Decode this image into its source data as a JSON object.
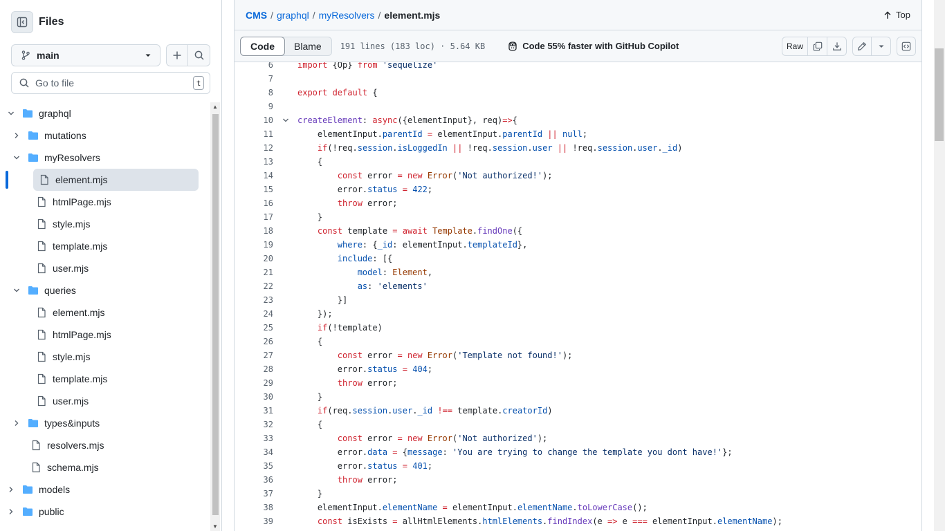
{
  "sidebar": {
    "title": "Files",
    "branch": "main",
    "goto_placeholder": "Go to file",
    "goto_shortcut": "t",
    "tree": [
      {
        "label": "graphql",
        "type": "folder",
        "depth": 1,
        "expanded": true
      },
      {
        "label": "mutations",
        "type": "folder",
        "depth": 2,
        "expanded": false
      },
      {
        "label": "myResolvers",
        "type": "folder",
        "depth": 2,
        "expanded": true
      },
      {
        "label": "element.mjs",
        "type": "file",
        "depth": 3,
        "active": true
      },
      {
        "label": "htmlPage.mjs",
        "type": "file",
        "depth": 3
      },
      {
        "label": "style.mjs",
        "type": "file",
        "depth": 3
      },
      {
        "label": "template.mjs",
        "type": "file",
        "depth": 3
      },
      {
        "label": "user.mjs",
        "type": "file",
        "depth": 3
      },
      {
        "label": "queries",
        "type": "folder",
        "depth": 2,
        "expanded": true
      },
      {
        "label": "element.mjs",
        "type": "file",
        "depth": 3
      },
      {
        "label": "htmlPage.mjs",
        "type": "file",
        "depth": 3
      },
      {
        "label": "style.mjs",
        "type": "file",
        "depth": 3
      },
      {
        "label": "template.mjs",
        "type": "file",
        "depth": 3
      },
      {
        "label": "user.mjs",
        "type": "file",
        "depth": 3
      },
      {
        "label": "types&inputs",
        "type": "folder",
        "depth": 2,
        "expanded": false
      },
      {
        "label": "resolvers.mjs",
        "type": "file",
        "depth": 2
      },
      {
        "label": "schema.mjs",
        "type": "file",
        "depth": 2
      },
      {
        "label": "models",
        "type": "folder",
        "depth": 1,
        "expanded": false
      },
      {
        "label": "public",
        "type": "folder",
        "depth": 1,
        "expanded": false
      }
    ]
  },
  "breadcrumb": {
    "parts": [
      "CMS",
      "graphql",
      "myResolvers"
    ],
    "separator": "/",
    "current": "element.mjs",
    "top_label": "Top"
  },
  "toolbar": {
    "code_tab": "Code",
    "blame_tab": "Blame",
    "file_info": "191 lines (183 loc) · 5.64 KB",
    "copilot": "Code 55% faster with GitHub Copilot",
    "raw_label": "Raw"
  },
  "colors": {
    "accent": "#0969da",
    "folder": "#54aeff",
    "keyword": "#cf222e",
    "function": "#6639ba",
    "property": "#0550ae",
    "string": "#0a3069"
  },
  "code_lines": [
    {
      "n": "6",
      "t": [
        [
          "k",
          "import "
        ],
        [
          "",
          "{Op} "
        ],
        [
          "k",
          "from "
        ],
        [
          "s",
          "'sequelize'"
        ]
      ]
    },
    {
      "n": "7",
      "t": []
    },
    {
      "n": "8",
      "t": [
        [
          "k",
          "export default "
        ],
        [
          "",
          "{"
        ]
      ]
    },
    {
      "n": "9",
      "t": []
    },
    {
      "n": "10",
      "fold": true,
      "t": [
        [
          "f",
          "createElement"
        ],
        [
          "",
          ": "
        ],
        [
          "k",
          "async"
        ],
        [
          "",
          "({elementInput}, req)"
        ],
        [
          "k",
          "=>"
        ],
        [
          "",
          "{"
        ]
      ]
    },
    {
      "n": "11",
      "t": [
        [
          "",
          "    elementInput."
        ],
        [
          "p",
          "parentId"
        ],
        [
          "",
          " "
        ],
        [
          "k",
          "="
        ],
        [
          "",
          " elementInput."
        ],
        [
          "p",
          "parentId"
        ],
        [
          "",
          " "
        ],
        [
          "k",
          "||"
        ],
        [
          "",
          " "
        ],
        [
          "n",
          "null"
        ],
        [
          "",
          ";"
        ]
      ]
    },
    {
      "n": "12",
      "t": [
        [
          "k",
          "    if"
        ],
        [
          "",
          "(!req."
        ],
        [
          "p",
          "session"
        ],
        [
          "",
          "."
        ],
        [
          "p",
          "isLoggedIn"
        ],
        [
          "",
          " "
        ],
        [
          "k",
          "||"
        ],
        [
          "",
          " !req."
        ],
        [
          "p",
          "session"
        ],
        [
          "",
          "."
        ],
        [
          "p",
          "user"
        ],
        [
          "",
          " "
        ],
        [
          "k",
          "||"
        ],
        [
          "",
          " !req."
        ],
        [
          "p",
          "session"
        ],
        [
          "",
          "."
        ],
        [
          "p",
          "user"
        ],
        [
          "",
          "."
        ],
        [
          "p",
          "_id"
        ],
        [
          "",
          ")"
        ]
      ]
    },
    {
      "n": "13",
      "t": [
        [
          "",
          "    {"
        ]
      ]
    },
    {
      "n": "14",
      "t": [
        [
          "k",
          "        const "
        ],
        [
          "",
          "error "
        ],
        [
          "k",
          "= new "
        ],
        [
          "c",
          "Error"
        ],
        [
          "",
          "("
        ],
        [
          "s",
          "'Not authorized!'"
        ],
        [
          "",
          ");"
        ]
      ]
    },
    {
      "n": "15",
      "t": [
        [
          "",
          "        error."
        ],
        [
          "p",
          "status"
        ],
        [
          "",
          " "
        ],
        [
          "k",
          "="
        ],
        [
          "",
          " "
        ],
        [
          "n",
          "422"
        ],
        [
          "",
          ";"
        ]
      ]
    },
    {
      "n": "16",
      "t": [
        [
          "k",
          "        throw "
        ],
        [
          "",
          "error;"
        ]
      ]
    },
    {
      "n": "17",
      "t": [
        [
          "",
          "    }"
        ]
      ]
    },
    {
      "n": "18",
      "t": [
        [
          "k",
          "    const "
        ],
        [
          "",
          "template "
        ],
        [
          "k",
          "= await "
        ],
        [
          "c",
          "Template"
        ],
        [
          "",
          "."
        ],
        [
          "f",
          "findOne"
        ],
        [
          "",
          "({"
        ]
      ]
    },
    {
      "n": "19",
      "t": [
        [
          "p",
          "        where"
        ],
        [
          "",
          ": {"
        ],
        [
          "p",
          "_id"
        ],
        [
          "",
          ": elementInput."
        ],
        [
          "p",
          "templateId"
        ],
        [
          "",
          "},"
        ]
      ]
    },
    {
      "n": "20",
      "t": [
        [
          "p",
          "        include"
        ],
        [
          "",
          ": [{"
        ]
      ]
    },
    {
      "n": "21",
      "t": [
        [
          "p",
          "            model"
        ],
        [
          "",
          ": "
        ],
        [
          "c",
          "Element"
        ],
        [
          "",
          ","
        ]
      ]
    },
    {
      "n": "22",
      "t": [
        [
          "p",
          "            as"
        ],
        [
          "",
          ": "
        ],
        [
          "s",
          "'elements'"
        ]
      ]
    },
    {
      "n": "23",
      "t": [
        [
          "",
          "        }]"
        ]
      ]
    },
    {
      "n": "24",
      "t": [
        [
          "",
          "    });"
        ]
      ]
    },
    {
      "n": "25",
      "t": [
        [
          "k",
          "    if"
        ],
        [
          "",
          "(!template)"
        ]
      ]
    },
    {
      "n": "26",
      "t": [
        [
          "",
          "    {"
        ]
      ]
    },
    {
      "n": "27",
      "t": [
        [
          "k",
          "        const "
        ],
        [
          "",
          "error "
        ],
        [
          "k",
          "= new "
        ],
        [
          "c",
          "Error"
        ],
        [
          "",
          "("
        ],
        [
          "s",
          "'Template not found!'"
        ],
        [
          "",
          ");"
        ]
      ]
    },
    {
      "n": "28",
      "t": [
        [
          "",
          "        error."
        ],
        [
          "p",
          "status"
        ],
        [
          "",
          " "
        ],
        [
          "k",
          "="
        ],
        [
          "",
          " "
        ],
        [
          "n",
          "404"
        ],
        [
          "",
          ";"
        ]
      ]
    },
    {
      "n": "29",
      "t": [
        [
          "k",
          "        throw "
        ],
        [
          "",
          "error;"
        ]
      ]
    },
    {
      "n": "30",
      "t": [
        [
          "",
          "    }"
        ]
      ]
    },
    {
      "n": "31",
      "t": [
        [
          "k",
          "    if"
        ],
        [
          "",
          "(req."
        ],
        [
          "p",
          "session"
        ],
        [
          "",
          "."
        ],
        [
          "p",
          "user"
        ],
        [
          "",
          "."
        ],
        [
          "p",
          "_id"
        ],
        [
          "",
          " "
        ],
        [
          "k",
          "!=="
        ],
        [
          "",
          " template."
        ],
        [
          "p",
          "creatorId"
        ],
        [
          "",
          ")"
        ]
      ]
    },
    {
      "n": "32",
      "t": [
        [
          "",
          "    {"
        ]
      ]
    },
    {
      "n": "33",
      "t": [
        [
          "k",
          "        const "
        ],
        [
          "",
          "error "
        ],
        [
          "k",
          "= new "
        ],
        [
          "c",
          "Error"
        ],
        [
          "",
          "("
        ],
        [
          "s",
          "'Not authorized'"
        ],
        [
          "",
          ");"
        ]
      ]
    },
    {
      "n": "34",
      "t": [
        [
          "",
          "        error."
        ],
        [
          "p",
          "data"
        ],
        [
          "",
          " "
        ],
        [
          "k",
          "="
        ],
        [
          "",
          " {"
        ],
        [
          "p",
          "message"
        ],
        [
          "",
          ": "
        ],
        [
          "s",
          "'You are trying to change the template you dont have!'"
        ],
        [
          "",
          "};"
        ]
      ]
    },
    {
      "n": "35",
      "t": [
        [
          "",
          "        error."
        ],
        [
          "p",
          "status"
        ],
        [
          "",
          " "
        ],
        [
          "k",
          "="
        ],
        [
          "",
          " "
        ],
        [
          "n",
          "401"
        ],
        [
          "",
          ";"
        ]
      ]
    },
    {
      "n": "36",
      "t": [
        [
          "k",
          "        throw "
        ],
        [
          "",
          "error;"
        ]
      ]
    },
    {
      "n": "37",
      "t": [
        [
          "",
          "    }"
        ]
      ]
    },
    {
      "n": "38",
      "t": [
        [
          "",
          "    elementInput."
        ],
        [
          "p",
          "elementName"
        ],
        [
          "",
          " "
        ],
        [
          "k",
          "="
        ],
        [
          "",
          " elementInput."
        ],
        [
          "p",
          "elementName"
        ],
        [
          "",
          "."
        ],
        [
          "f",
          "toLowerCase"
        ],
        [
          "",
          "();"
        ]
      ]
    },
    {
      "n": "39",
      "t": [
        [
          "k",
          "    const "
        ],
        [
          "",
          "isExists "
        ],
        [
          "k",
          "="
        ],
        [
          "",
          " allHtmlElements."
        ],
        [
          "p",
          "htmlElements"
        ],
        [
          "",
          "."
        ],
        [
          "f",
          "findIndex"
        ],
        [
          "",
          "(e "
        ],
        [
          "k",
          "=>"
        ],
        [
          "",
          " e "
        ],
        [
          "k",
          "==="
        ],
        [
          "",
          " elementInput."
        ],
        [
          "p",
          "elementName"
        ],
        [
          "",
          ");"
        ]
      ]
    }
  ]
}
